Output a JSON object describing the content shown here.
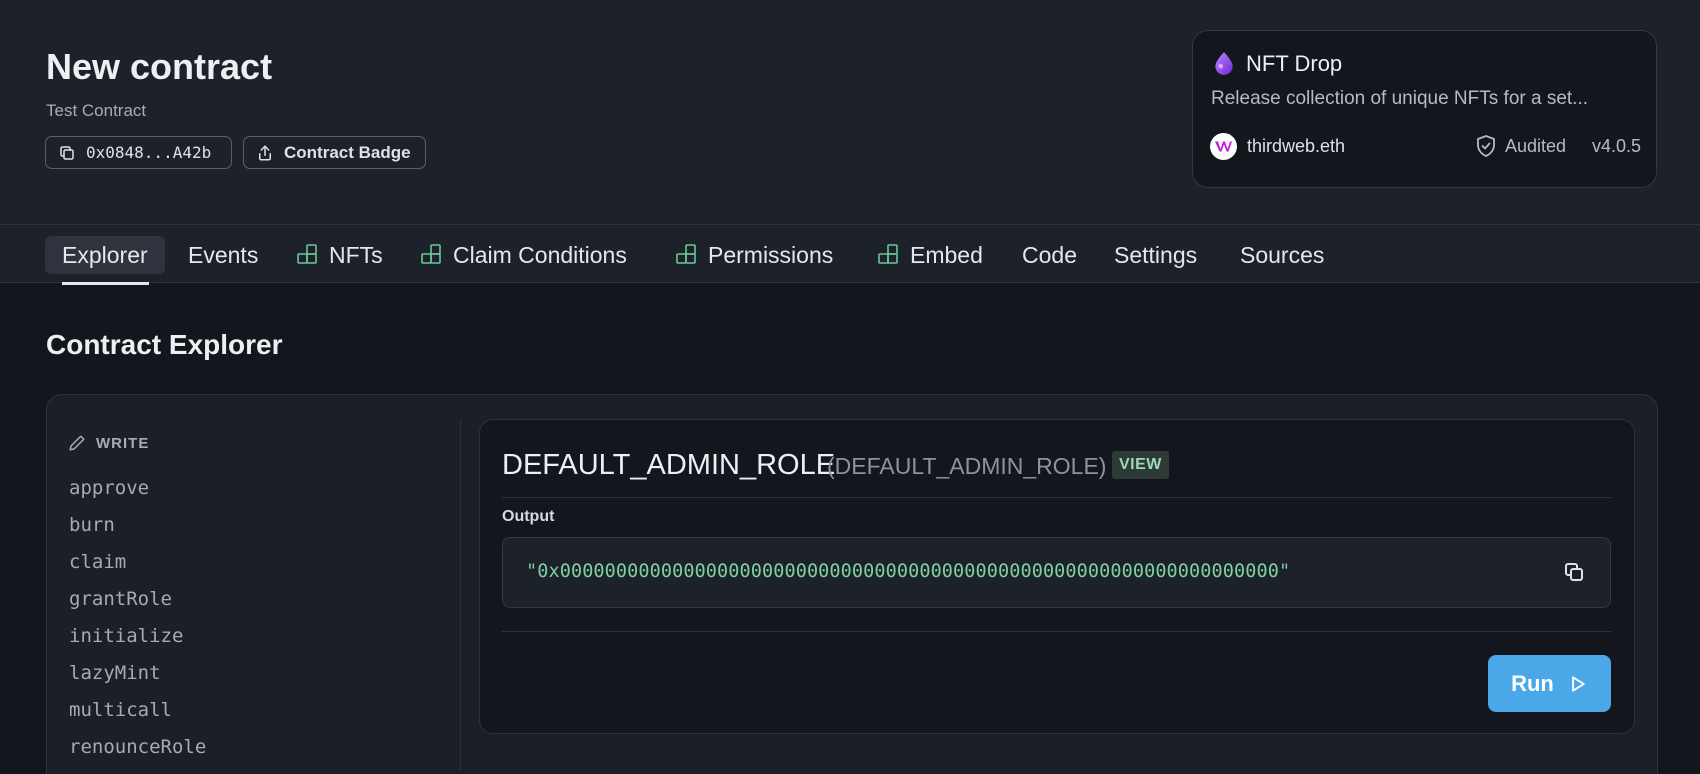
{
  "header": {
    "title": "New contract",
    "subtitle": "Test Contract",
    "address": "0x0848...A42b",
    "badge_label": "Contract Badge"
  },
  "card": {
    "title": "NFT Drop",
    "description": "Release collection of unique NFTs for a set...",
    "author": "thirdweb.eth",
    "audited_label": "Audited",
    "version": "v4.0.5",
    "icon": "drop-icon",
    "brand_color": "#8b5cf6"
  },
  "tabs": [
    {
      "label": "Explorer",
      "active": true,
      "icon": null
    },
    {
      "label": "Events",
      "active": false,
      "icon": null
    },
    {
      "label": "NFTs",
      "active": false,
      "icon": "extension-icon"
    },
    {
      "label": "Claim Conditions",
      "active": false,
      "icon": "extension-icon"
    },
    {
      "label": "Permissions",
      "active": false,
      "icon": "extension-icon"
    },
    {
      "label": "Embed",
      "active": false,
      "icon": "extension-icon"
    },
    {
      "label": "Code",
      "active": false,
      "icon": null
    },
    {
      "label": "Settings",
      "active": false,
      "icon": null
    },
    {
      "label": "Sources",
      "active": false,
      "icon": null
    }
  ],
  "explorer": {
    "section_title": "Contract Explorer",
    "write_heading": "WRITE",
    "functions": [
      "approve",
      "burn",
      "claim",
      "grantRole",
      "initialize",
      "lazyMint",
      "multicall",
      "renounceRole"
    ]
  },
  "detail": {
    "function_name": "DEFAULT_ADMIN_ROLE",
    "signature": "(DEFAULT_ADMIN_ROLE)",
    "badge": "VIEW",
    "output_label": "Output",
    "output_value": "\"0x0000000000000000000000000000000000000000000000000000000000000000\"",
    "run_label": "Run",
    "accent_color": "#4aa8e8",
    "output_color": "#7fcf9f"
  }
}
